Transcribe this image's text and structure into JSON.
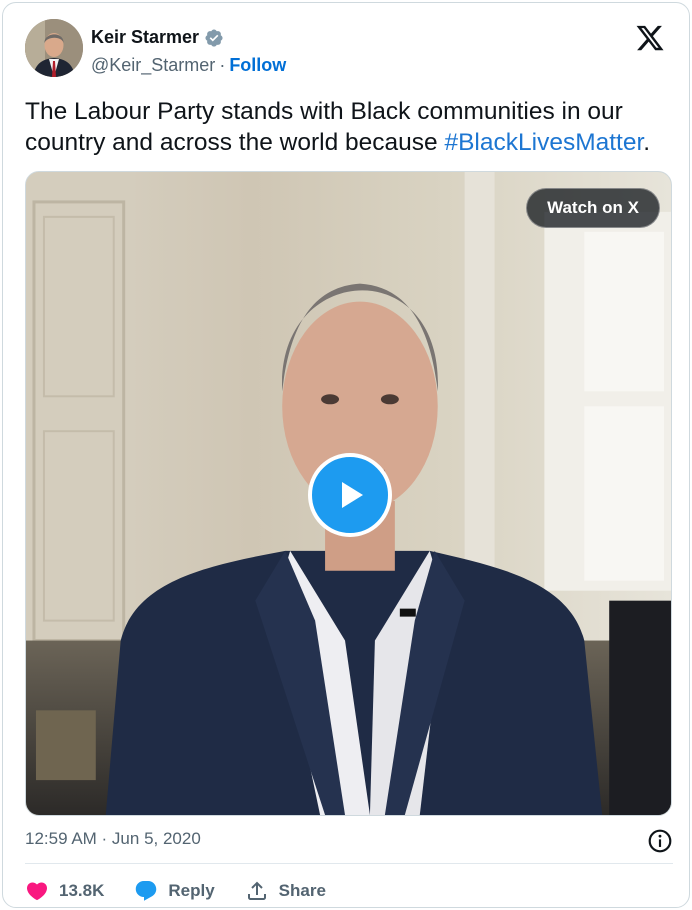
{
  "author": {
    "name": "Keir Starmer",
    "handle": "@Keir_Starmer",
    "separator": "·",
    "follow_label": "Follow"
  },
  "tweet": {
    "text": "The Labour Party stands with Black communities in our country and across the world because ",
    "hashtag": "#BlackLivesMatter",
    "text_end": "."
  },
  "media": {
    "watch_label": "Watch on X"
  },
  "timestamp": "12:59 AM · Jun 5, 2020",
  "actions": {
    "like_count": "13.8K",
    "reply_label": "Reply",
    "share_label": "Share"
  },
  "colors": {
    "link": "#006fd6",
    "hashtag": "#1d76d2",
    "like": "#f91880",
    "reply": "#1d9bf0",
    "play": "#1d9bf0"
  },
  "icons": [
    "verified-badge-icon",
    "x-logo-icon",
    "play-icon",
    "info-icon",
    "heart-icon",
    "reply-icon",
    "share-icon"
  ]
}
